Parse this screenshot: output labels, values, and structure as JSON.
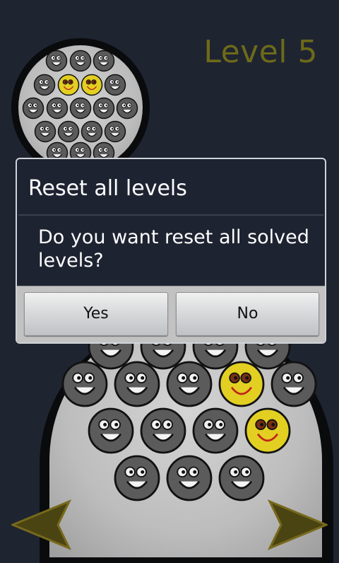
{
  "level": {
    "label": "Level 5"
  },
  "dialog": {
    "title": "Reset all levels",
    "message": "Do you want reset all solved levels?",
    "yes_label": "Yes",
    "no_label": "No"
  },
  "colors": {
    "background": "#1f2431",
    "level_text": "#6d6a19",
    "grey_ball": "#5a5a5a",
    "yellow_ball": "#e6d321",
    "arrow": "#5b5314"
  },
  "icons": {
    "prev": "left-arrow-icon",
    "next": "right-arrow-icon",
    "grey_ball": "grey-smiley-ball-icon",
    "yellow_ball": "yellow-smiley-ball-icon"
  }
}
